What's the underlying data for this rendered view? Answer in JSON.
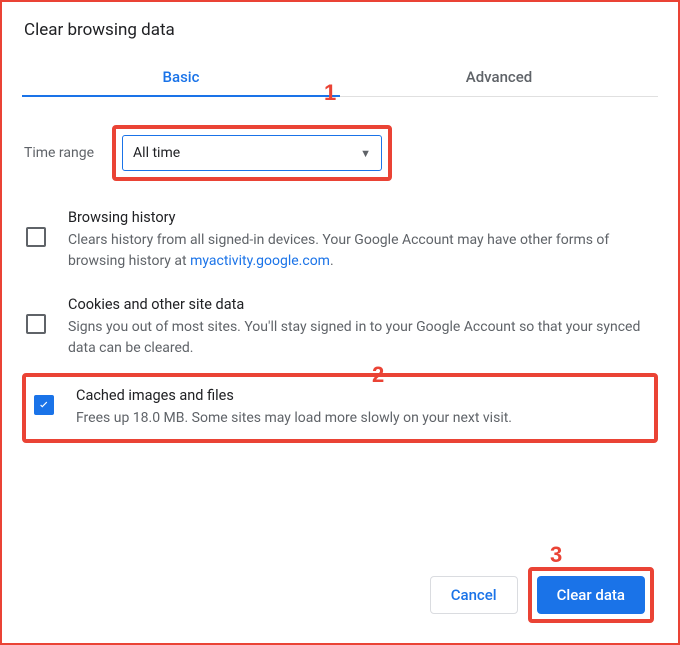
{
  "title": "Clear browsing data",
  "tabs": {
    "basic": "Basic",
    "advanced": "Advanced"
  },
  "time_range": {
    "label": "Time range",
    "value": "All time"
  },
  "options": {
    "history": {
      "title": "Browsing history",
      "desc_pre": "Clears history from all signed-in devices. Your Google Account may have other forms of browsing history at ",
      "link_text": "myactivity.google.com",
      "desc_post": "."
    },
    "cookies": {
      "title": "Cookies and other site data",
      "desc": "Signs you out of most sites. You'll stay signed in to your Google Account so that your synced data can be cleared."
    },
    "cache": {
      "title": "Cached images and files",
      "desc": "Frees up 18.0 MB. Some sites may load more slowly on your next visit."
    }
  },
  "buttons": {
    "cancel": "Cancel",
    "clear": "Clear data"
  },
  "annotations": {
    "n1": "1",
    "n2": "2",
    "n3": "3"
  }
}
